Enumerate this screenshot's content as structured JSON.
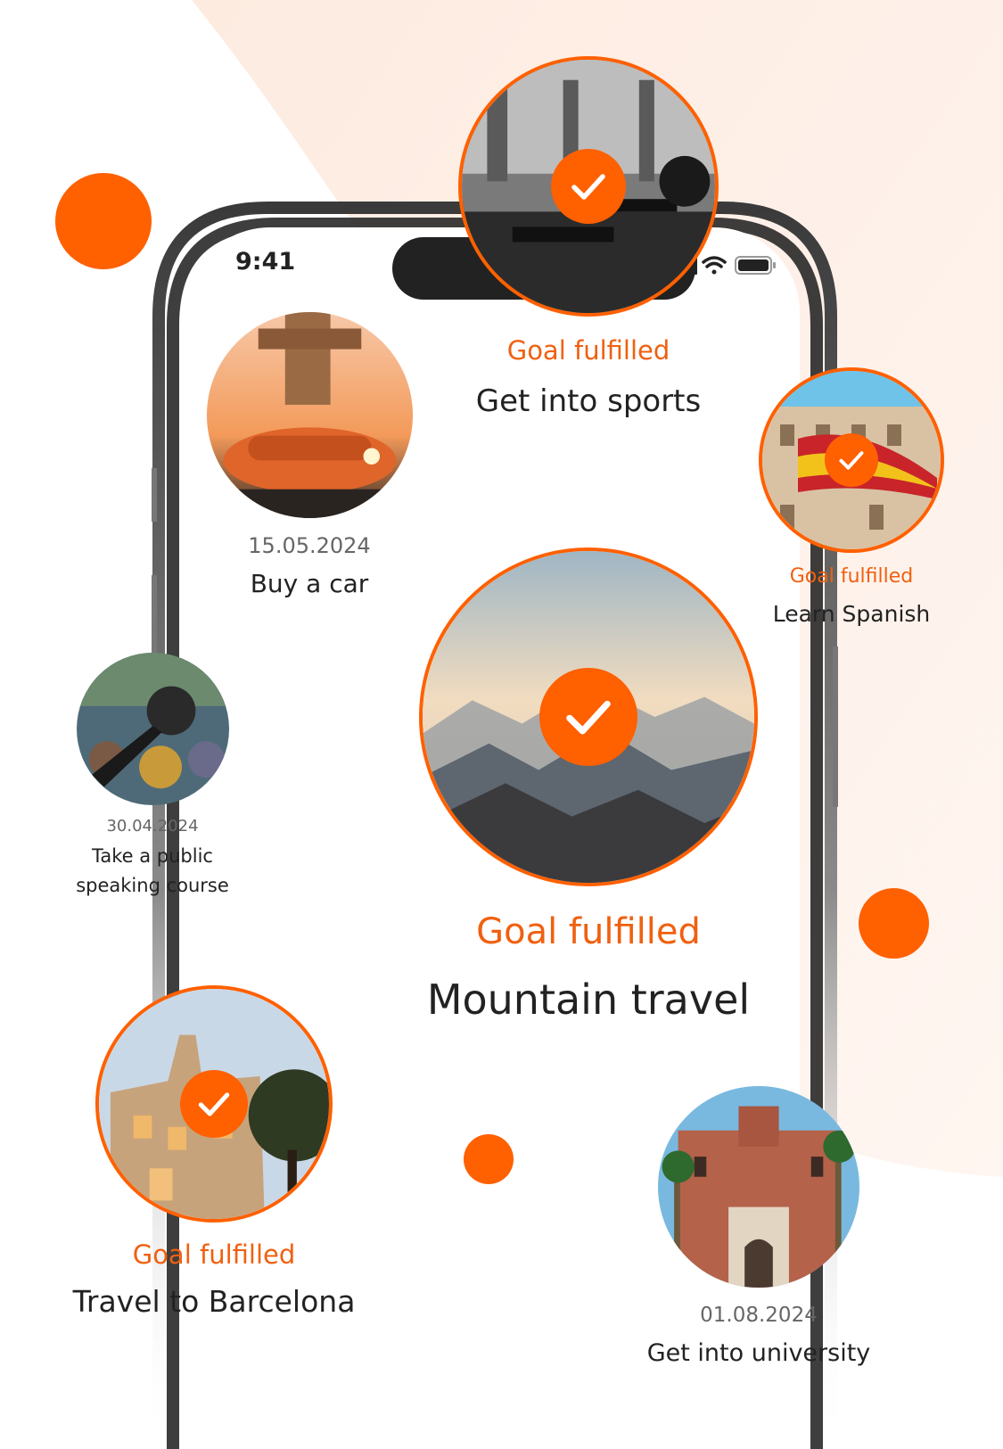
{
  "status_bar": {
    "time": "9:41"
  },
  "colors": {
    "accent": "#ff6000",
    "background_tint": "#fff2ea",
    "text": "#222222",
    "muted": "#666666"
  },
  "goals": {
    "sports": {
      "status": "Goal fulfilled",
      "title": "Get into sports",
      "image": "gym-photo",
      "completed": true
    },
    "car": {
      "date": "15.05.2024",
      "title": "Buy a car",
      "image": "car-photo",
      "completed": false
    },
    "spanish": {
      "status": "Goal fulfilled",
      "title": "Learn Spanish",
      "image": "spanish-flag-photo",
      "completed": true
    },
    "mountain": {
      "status": "Goal fulfilled",
      "title": "Mountain travel",
      "image": "mountains-photo",
      "completed": true
    },
    "speaking": {
      "date": "30.04.2024",
      "title_line1": "Take a public",
      "title_line2": "speaking course",
      "image": "microphone-photo",
      "completed": false
    },
    "barcelona": {
      "status": "Goal fulfilled",
      "title": "Travel to Barcelona",
      "image": "barcelona-photo",
      "completed": true
    },
    "university": {
      "date": "01.08.2024",
      "title": "Get into university",
      "image": "university-photo",
      "completed": false
    }
  },
  "icons": [
    "checkmark-icon",
    "signal-icon",
    "wifi-icon",
    "battery-icon"
  ]
}
